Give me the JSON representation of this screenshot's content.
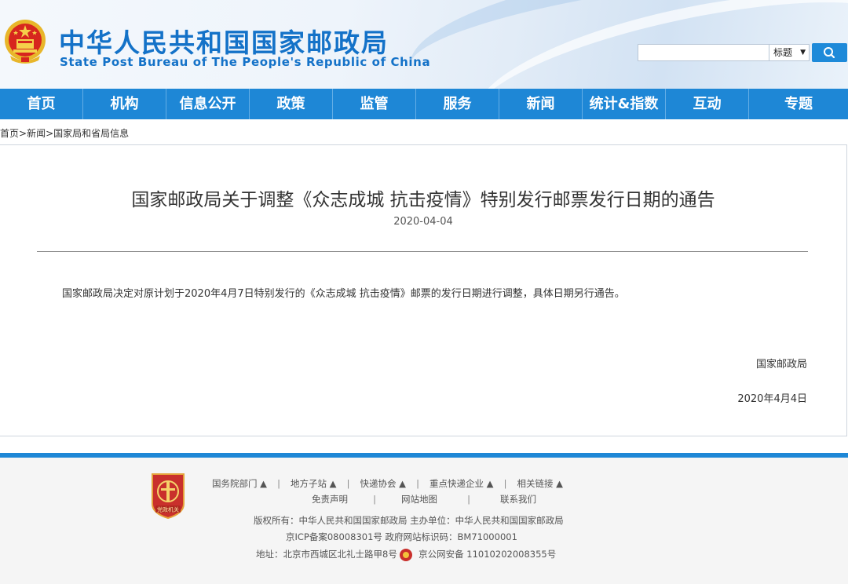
{
  "header": {
    "title_cn": "中华人民共和国国家邮政局",
    "title_en": "State Post Bureau of The People's Republic of China",
    "search": {
      "value": "",
      "select_label": "标题",
      "select_arrow": "▼"
    }
  },
  "nav": {
    "items": [
      "首页",
      "机构",
      "信息公开",
      "政策",
      "监管",
      "服务",
      "新闻",
      "统计&指数",
      "互动",
      "专题"
    ]
  },
  "breadcrumb": {
    "items": [
      "首页",
      "新闻",
      "国家局和省局信息"
    ],
    "separator": ">"
  },
  "article": {
    "title": "国家邮政局关于调整《众志成城 抗击疫情》特别发行邮票发行日期的通告",
    "date": "2020-04-04",
    "body": "国家邮政局决定对原计划于2020年4月7日特别发行的《众志成城  抗击疫情》邮票的发行日期进行调整，具体日期另行通告。",
    "signature": "国家邮政局",
    "sign_date": "2020年4月4日"
  },
  "footer": {
    "links_row1": [
      "国务院部门 ▲",
      "地方子站 ▲",
      "快递协会 ▲",
      "重点快递企业 ▲",
      "相关链接 ▲"
    ],
    "links_row2": [
      "免责声明",
      "网站地图",
      "联系我们"
    ],
    "separator": "|",
    "copyright": "版权所有：中华人民共和国国家邮政局   主办单位：中华人民共和国国家邮政局",
    "icp": "京ICP备案08008301号   政府网站标识码：BM71000001",
    "address": "地址：北京市西城区北礼士路甲8号",
    "police": "京公网安备 11010202008355号",
    "badge_text": "党政机关"
  },
  "colors": {
    "brand_blue": "#1e87d6",
    "title_blue": "#1472c8",
    "badge_red": "#c9302c"
  }
}
